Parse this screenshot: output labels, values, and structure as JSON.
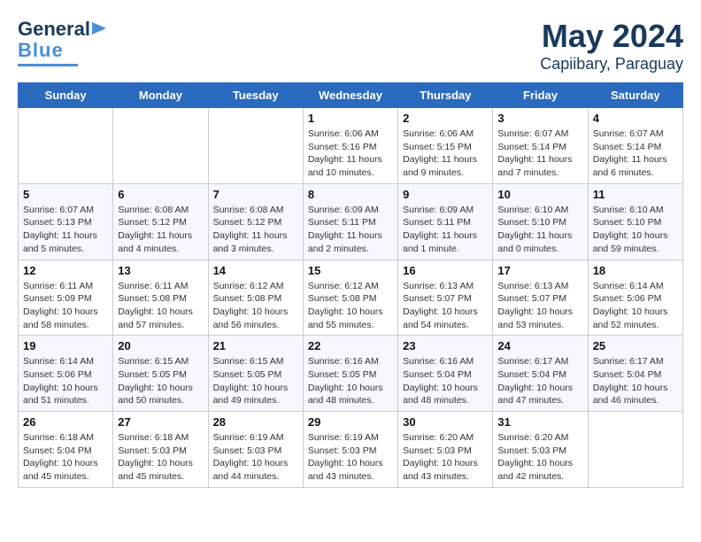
{
  "header": {
    "logo_line1": "General",
    "logo_line2": "Blue",
    "month": "May 2024",
    "location": "Capiibary, Paraguay"
  },
  "days_of_week": [
    "Sunday",
    "Monday",
    "Tuesday",
    "Wednesday",
    "Thursday",
    "Friday",
    "Saturday"
  ],
  "weeks": [
    [
      {
        "num": "",
        "info": ""
      },
      {
        "num": "",
        "info": ""
      },
      {
        "num": "",
        "info": ""
      },
      {
        "num": "1",
        "info": "Sunrise: 6:06 AM\nSunset: 5:16 PM\nDaylight: 11 hours\nand 10 minutes."
      },
      {
        "num": "2",
        "info": "Sunrise: 6:06 AM\nSunset: 5:15 PM\nDaylight: 11 hours\nand 9 minutes."
      },
      {
        "num": "3",
        "info": "Sunrise: 6:07 AM\nSunset: 5:14 PM\nDaylight: 11 hours\nand 7 minutes."
      },
      {
        "num": "4",
        "info": "Sunrise: 6:07 AM\nSunset: 5:14 PM\nDaylight: 11 hours\nand 6 minutes."
      }
    ],
    [
      {
        "num": "5",
        "info": "Sunrise: 6:07 AM\nSunset: 5:13 PM\nDaylight: 11 hours\nand 5 minutes."
      },
      {
        "num": "6",
        "info": "Sunrise: 6:08 AM\nSunset: 5:12 PM\nDaylight: 11 hours\nand 4 minutes."
      },
      {
        "num": "7",
        "info": "Sunrise: 6:08 AM\nSunset: 5:12 PM\nDaylight: 11 hours\nand 3 minutes."
      },
      {
        "num": "8",
        "info": "Sunrise: 6:09 AM\nSunset: 5:11 PM\nDaylight: 11 hours\nand 2 minutes."
      },
      {
        "num": "9",
        "info": "Sunrise: 6:09 AM\nSunset: 5:11 PM\nDaylight: 11 hours\nand 1 minute."
      },
      {
        "num": "10",
        "info": "Sunrise: 6:10 AM\nSunset: 5:10 PM\nDaylight: 11 hours\nand 0 minutes."
      },
      {
        "num": "11",
        "info": "Sunrise: 6:10 AM\nSunset: 5:10 PM\nDaylight: 10 hours\nand 59 minutes."
      }
    ],
    [
      {
        "num": "12",
        "info": "Sunrise: 6:11 AM\nSunset: 5:09 PM\nDaylight: 10 hours\nand 58 minutes."
      },
      {
        "num": "13",
        "info": "Sunrise: 6:11 AM\nSunset: 5:08 PM\nDaylight: 10 hours\nand 57 minutes."
      },
      {
        "num": "14",
        "info": "Sunrise: 6:12 AM\nSunset: 5:08 PM\nDaylight: 10 hours\nand 56 minutes."
      },
      {
        "num": "15",
        "info": "Sunrise: 6:12 AM\nSunset: 5:08 PM\nDaylight: 10 hours\nand 55 minutes."
      },
      {
        "num": "16",
        "info": "Sunrise: 6:13 AM\nSunset: 5:07 PM\nDaylight: 10 hours\nand 54 minutes."
      },
      {
        "num": "17",
        "info": "Sunrise: 6:13 AM\nSunset: 5:07 PM\nDaylight: 10 hours\nand 53 minutes."
      },
      {
        "num": "18",
        "info": "Sunrise: 6:14 AM\nSunset: 5:06 PM\nDaylight: 10 hours\nand 52 minutes."
      }
    ],
    [
      {
        "num": "19",
        "info": "Sunrise: 6:14 AM\nSunset: 5:06 PM\nDaylight: 10 hours\nand 51 minutes."
      },
      {
        "num": "20",
        "info": "Sunrise: 6:15 AM\nSunset: 5:05 PM\nDaylight: 10 hours\nand 50 minutes."
      },
      {
        "num": "21",
        "info": "Sunrise: 6:15 AM\nSunset: 5:05 PM\nDaylight: 10 hours\nand 49 minutes."
      },
      {
        "num": "22",
        "info": "Sunrise: 6:16 AM\nSunset: 5:05 PM\nDaylight: 10 hours\nand 48 minutes."
      },
      {
        "num": "23",
        "info": "Sunrise: 6:16 AM\nSunset: 5:04 PM\nDaylight: 10 hours\nand 48 minutes."
      },
      {
        "num": "24",
        "info": "Sunrise: 6:17 AM\nSunset: 5:04 PM\nDaylight: 10 hours\nand 47 minutes."
      },
      {
        "num": "25",
        "info": "Sunrise: 6:17 AM\nSunset: 5:04 PM\nDaylight: 10 hours\nand 46 minutes."
      }
    ],
    [
      {
        "num": "26",
        "info": "Sunrise: 6:18 AM\nSunset: 5:04 PM\nDaylight: 10 hours\nand 45 minutes."
      },
      {
        "num": "27",
        "info": "Sunrise: 6:18 AM\nSunset: 5:03 PM\nDaylight: 10 hours\nand 45 minutes."
      },
      {
        "num": "28",
        "info": "Sunrise: 6:19 AM\nSunset: 5:03 PM\nDaylight: 10 hours\nand 44 minutes."
      },
      {
        "num": "29",
        "info": "Sunrise: 6:19 AM\nSunset: 5:03 PM\nDaylight: 10 hours\nand 43 minutes."
      },
      {
        "num": "30",
        "info": "Sunrise: 6:20 AM\nSunset: 5:03 PM\nDaylight: 10 hours\nand 43 minutes."
      },
      {
        "num": "31",
        "info": "Sunrise: 6:20 AM\nSunset: 5:03 PM\nDaylight: 10 hours\nand 42 minutes."
      },
      {
        "num": "",
        "info": ""
      }
    ]
  ]
}
